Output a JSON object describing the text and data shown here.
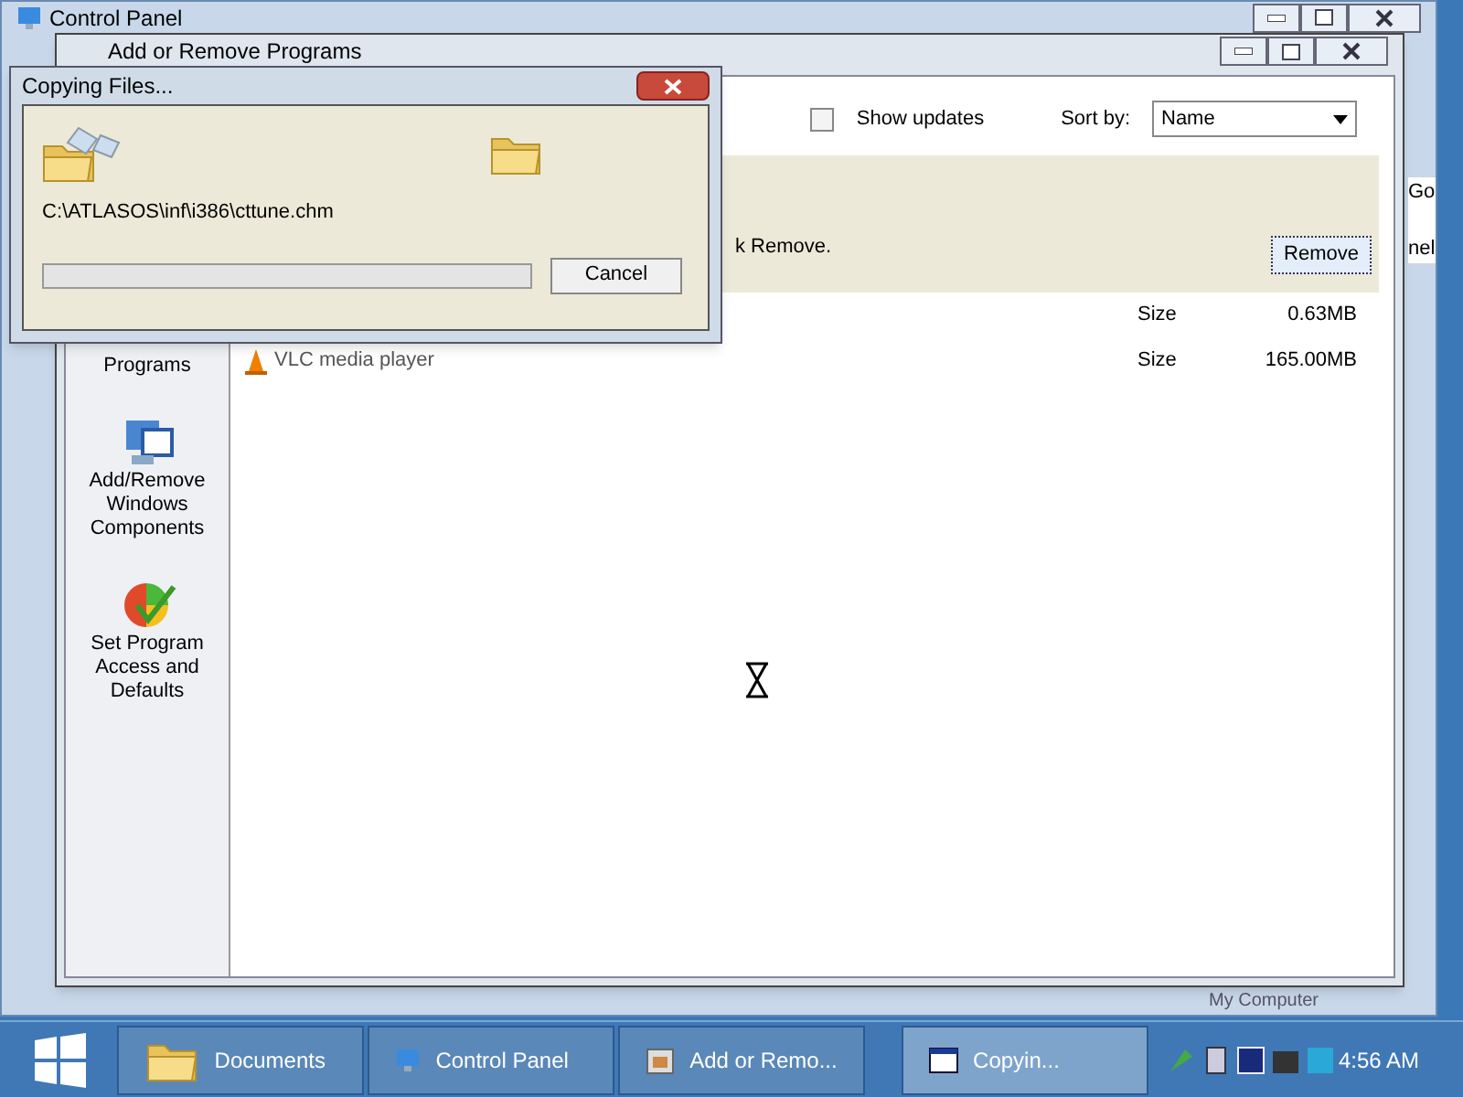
{
  "control_panel": {
    "title": "Control Panel",
    "side_texts": [
      "Go",
      "nel"
    ],
    "bottom_text": "My Computer"
  },
  "arp_window": {
    "title": "Add or Remove Programs",
    "show_updates": {
      "label": "Show updates",
      "checked": false
    },
    "sort_label": "Sort by:",
    "sort_value": "Name",
    "selected_hint": "k Remove.",
    "remove_button": "Remove",
    "programs": [
      {
        "size_label": "Size",
        "size": "0.63MB"
      },
      {
        "name": "VLC media player",
        "size_label": "Size",
        "size": "165.00MB"
      }
    ],
    "sidebar": [
      {
        "label": "Programs",
        "kind": "cd"
      },
      {
        "label": "Add/Remove Windows Components",
        "kind": "components"
      },
      {
        "label": "Set Program Access and Defaults",
        "kind": "access"
      }
    ]
  },
  "copy_dialog": {
    "title": "Copying Files...",
    "file": "C:\\ATLASOS\\inf\\i386\\cttune.chm",
    "level": 0,
    "cancel": "Cancel"
  },
  "taskbar": {
    "items": [
      {
        "label": "Documents",
        "kind": "folder",
        "selected": false
      },
      {
        "label": "Control Panel",
        "kind": "panel",
        "selected": false
      },
      {
        "label": "Add or Remo...",
        "kind": "programs",
        "selected": false
      },
      {
        "label": "Copyin...",
        "kind": "window",
        "selected": true
      }
    ],
    "clock": "4:56 AM"
  }
}
